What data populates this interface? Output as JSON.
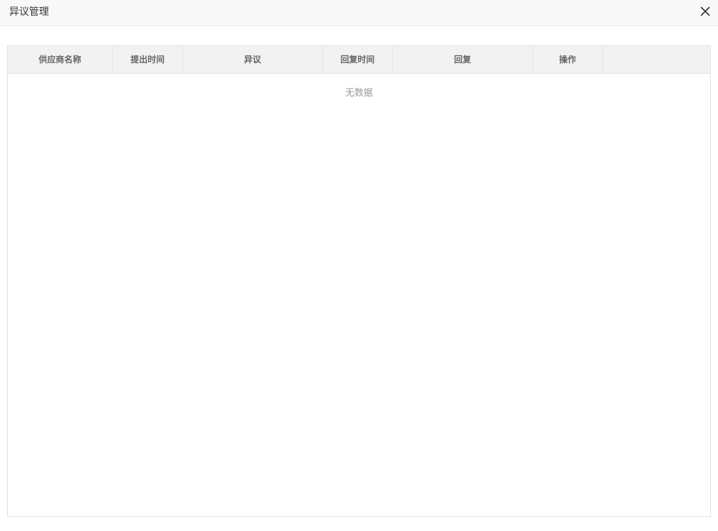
{
  "dialog": {
    "title": "异议管理",
    "close_icon": "close-icon"
  },
  "table": {
    "columns": [
      "供应商名称",
      "提出时间",
      "异议",
      "回复时间",
      "回复",
      "操作",
      ""
    ],
    "rows": [],
    "empty_text": "无数据"
  },
  "colors": {
    "header_bg": "#f8f8f8",
    "table_header_bg": "#f2f2f2",
    "border": "#e2e2e2",
    "empty_text": "#999999"
  }
}
